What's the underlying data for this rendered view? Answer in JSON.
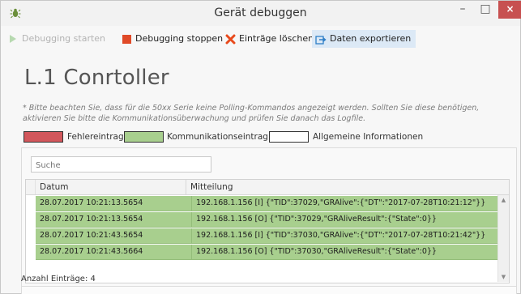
{
  "window": {
    "title": "Gerät debuggen",
    "minimize_glyph": "–",
    "maximize_glyph": "□",
    "close_glyph": "×",
    "app_icon": "bug-icon"
  },
  "toolbar": {
    "start": {
      "label": "Debugging starten",
      "icon": "play-icon",
      "color": "#b7d9b0"
    },
    "stop": {
      "label": "Debugging stoppen",
      "icon": "stop-square-icon",
      "color": "#e04a28"
    },
    "delete": {
      "label": "Einträge löschen",
      "icon": "delete-x-icon",
      "color": "#e84a1c"
    },
    "export": {
      "label": "Daten exportieren",
      "icon": "export-icon",
      "color": "#2f7fc7"
    }
  },
  "controller_title": "L.1 Conrtoller",
  "note": "* Bitte beachten Sie, dass für die 50xx Serie keine Polling-Kommandos angezeigt werden. Sollten Sie diese benötigen, aktivieren Sie bitte die Kommunikationsüberwachung und prüfen Sie danach das Logfile.",
  "legend": [
    {
      "label": "Fehlereintrag",
      "color": "#d2575c"
    },
    {
      "label": "Kommunikationseintrag",
      "color": "#a8cf8e"
    },
    {
      "label": "Allgemeine Informationen",
      "color": "#ffffff"
    }
  ],
  "search": {
    "placeholder": "Suche",
    "value": ""
  },
  "table": {
    "columns": [
      "Datum",
      "Mitteilung"
    ],
    "rows": [
      {
        "date": "28.07.2017 10:21:13.5654",
        "message": "192.168.1.156 [I] {\"TID\":37029,\"GRAlive\":{\"DT\":\"2017-07-28T10:21:12\"}}"
      },
      {
        "date": "28.07.2017 10:21:13.5654",
        "message": "192.168.1.156 [O] {\"TID\":37029,\"GRAliveResult\":{\"State\":0}}"
      },
      {
        "date": "28.07.2017 10:21:43.5654",
        "message": "192.168.1.156 [I] {\"TID\":37030,\"GRAlive\":{\"DT\":\"2017-07-28T10:21:42\"}}"
      },
      {
        "date": "28.07.2017 10:21:43.5664",
        "message": "192.168.1.156 [O] {\"TID\":37030,\"GRAliveResult\":{\"State\":0}}"
      }
    ]
  },
  "status": {
    "count_label": "Anzahl Einträge: 4"
  }
}
